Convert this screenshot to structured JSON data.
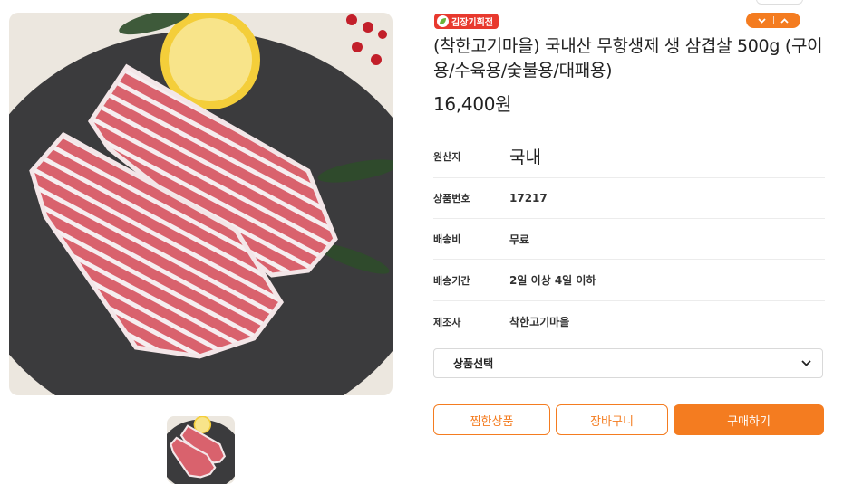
{
  "product": {
    "badge": "김장기획전",
    "title": "(착한고기마을) 국내산 무항생제 생 삼겹살 500g (구이용/수육용/숯불용/대패용)",
    "price": "16,400원"
  },
  "info_rows": [
    {
      "label": "원산지",
      "value": "국내"
    },
    {
      "label": "상품번호",
      "value": "17217"
    },
    {
      "label": "배송비",
      "value": "무료"
    },
    {
      "label": "배송기간",
      "value": "2일 이상 4일 이하"
    },
    {
      "label": "제조사",
      "value": "착한고기마을"
    }
  ],
  "option_select": {
    "label": "상품선택"
  },
  "buttons": {
    "wish": "찜한상품",
    "cart": "장바구니",
    "buy": "구매하기"
  },
  "colors": {
    "accent": "#f47c20",
    "badge": "#e8392e"
  },
  "icons": {
    "select_arrow": "chevron-down-icon",
    "nav_up": "chevron-up-icon",
    "nav_down": "chevron-down-icon",
    "badge": "leaf-icon"
  }
}
